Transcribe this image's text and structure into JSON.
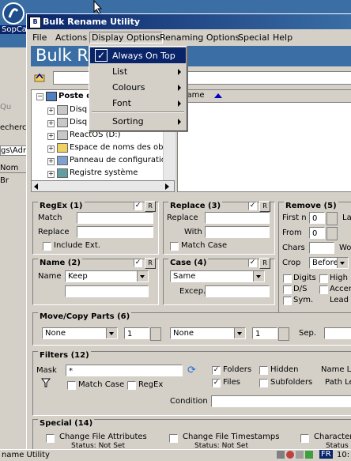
{
  "desktop": {
    "icon_label": "SopCa"
  },
  "bgwin": {
    "strip1": "Qu",
    "strip2": "echerc",
    "strip3": "gs\\Adr",
    "strip4": "Nom",
    "strip5": "Br"
  },
  "window": {
    "title": "Bulk Rename Utility"
  },
  "menubar": {
    "file": "File",
    "actions": "Actions",
    "display": "Display Options",
    "renaming": "Renaming Options",
    "special": "Special",
    "help": "Help"
  },
  "banner": {
    "text": "Bulk R"
  },
  "tree": {
    "root": "Poste d",
    "items": [
      "Disq",
      "Disq",
      "ReactOS (D:)",
      "Espace de noms des objet",
      "Panneau de configuration",
      "Registre système"
    ]
  },
  "filelist": {
    "col_name": "Name"
  },
  "menu": {
    "items": [
      {
        "label": "Always On Top",
        "checked": true
      },
      {
        "label": "List"
      },
      {
        "label": "Colours"
      },
      {
        "label": "Font"
      },
      {
        "label": "Sorting"
      }
    ]
  },
  "regex": {
    "title": "RegEx (1)",
    "match": "Match",
    "replace": "Replace",
    "include_ext": "Include Ext.",
    "r": "R"
  },
  "replace": {
    "title": "Replace (3)",
    "replace": "Replace",
    "with": "With",
    "match_case": "Match Case",
    "r": "R"
  },
  "remove": {
    "title": "Remove (5)",
    "first_n": "First n",
    "first_val": "0",
    "from": "From",
    "from_val": "0",
    "chars": "Chars",
    "crop": "Crop",
    "crop_val": "Before",
    "digits": "Digits",
    "ds": "D/S",
    "sym": "Sym.",
    "high": "High",
    "accents": "Accen",
    "lead": "Lead D",
    "la": "La",
    "wo": "Wo"
  },
  "name": {
    "title": "Name (2)",
    "label": "Name",
    "value": "Keep",
    "r": "R"
  },
  "case": {
    "title": "Case (4)",
    "value": "Same",
    "excep": "Excep.",
    "r": "R"
  },
  "movecopy": {
    "title": "Move/Copy Parts (6)",
    "sel1": "None",
    "num1": "1",
    "sel2": "None",
    "num2": "1",
    "sep": "Sep."
  },
  "filters": {
    "title": "Filters (12)",
    "mask": "Mask",
    "mask_val": "*",
    "match_case": "Match Case",
    "regex": "RegEx",
    "folders": "Folders",
    "files": "Files",
    "hidden": "Hidden",
    "subfolders": "Subfolders",
    "name_len": "Name Le",
    "path_len": "Path Le",
    "condition": "Condition"
  },
  "special": {
    "title": "Special (14)",
    "attr": "Change File Attributes",
    "timestamps": "Change File Timestamps",
    "char": "Character T",
    "status1": "Status:  Not Set",
    "status2": "Status:  Not Set",
    "status3": "Status"
  },
  "taskbar": {
    "app": "name Utility",
    "lang": "FR",
    "time": "10:"
  }
}
